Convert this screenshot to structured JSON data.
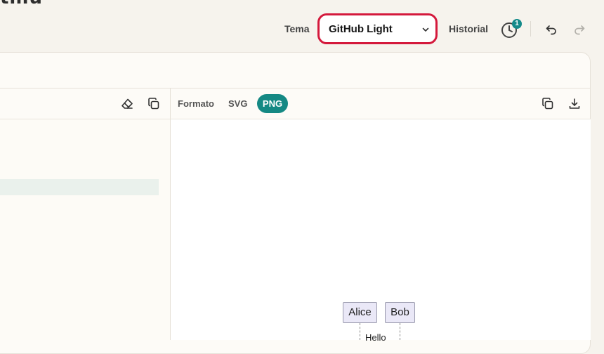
{
  "app": {
    "title_fragment": "tmu"
  },
  "topbar": {
    "theme_label": "Tema",
    "theme_value": "GitHub Light",
    "history_label": "Historial",
    "history_badge": "1"
  },
  "editor_toolbar": {
    "icons": [
      "eraser-icon",
      "copy-icon"
    ]
  },
  "preview_toolbar": {
    "format_label": "Formato",
    "formats": [
      "SVG",
      "PNG"
    ],
    "selected_format": "PNG",
    "icons": [
      "copy-icon",
      "download-icon"
    ]
  },
  "diagram": {
    "actors": [
      "Alice",
      "Bob"
    ],
    "message": "Hello"
  },
  "colors": {
    "accent": "#158984",
    "focus_ring": "#d4193c",
    "badge": "#138a8a",
    "highlight": "#eaf1ec"
  }
}
